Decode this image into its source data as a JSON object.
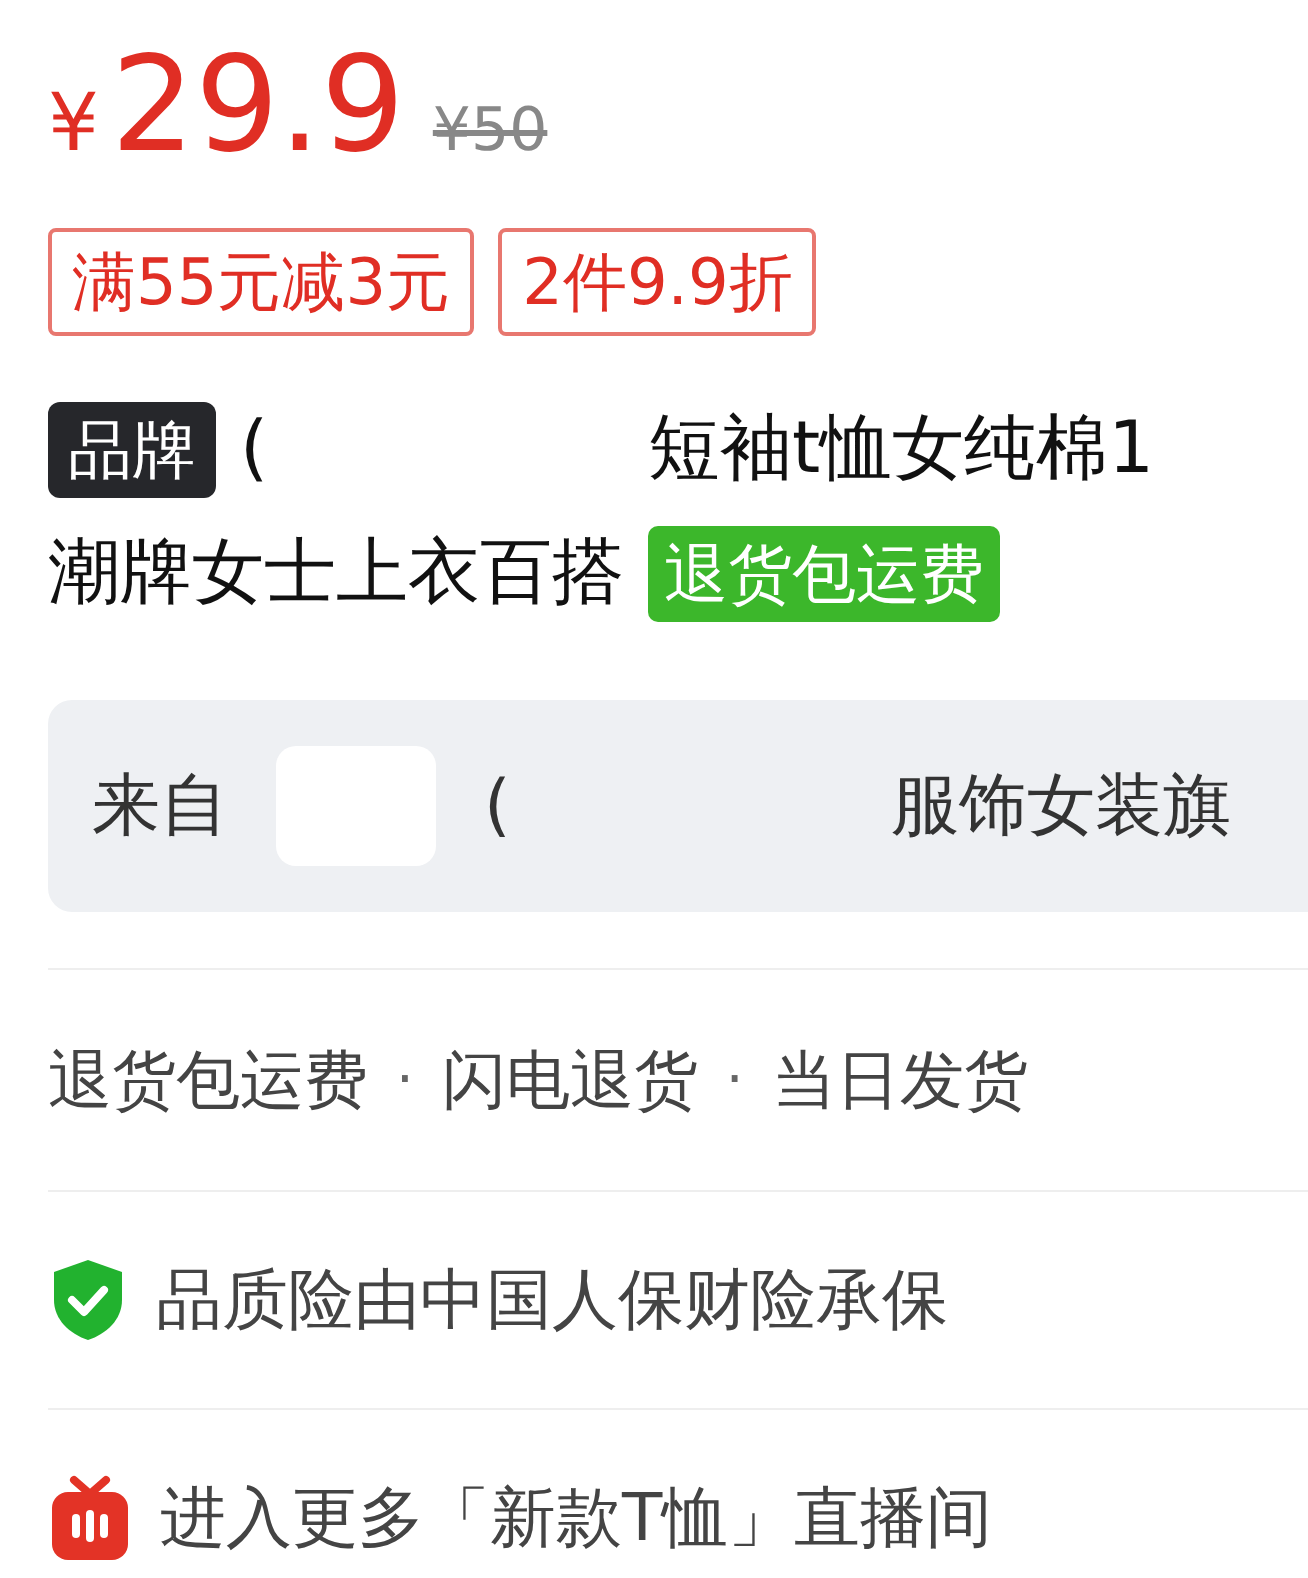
{
  "price": {
    "currency": "¥",
    "amount": "29.9",
    "original": "¥50"
  },
  "coupons": [
    "满55元减3元",
    "2件9.9折"
  ],
  "title": {
    "badge": "品牌",
    "line1_start": "(",
    "line1_end": "短袖t恤女纯棉1",
    "line2": "潮牌女士上衣百搭",
    "tag": "退货包运费"
  },
  "store": {
    "prefix": "来自",
    "name_start": "(",
    "name_end": "服饰女装旗"
  },
  "services": [
    {
      "label": "退货包运费"
    },
    {
      "label": "闪电退货"
    },
    {
      "label": "当日发货"
    }
  ],
  "service_separator": "·",
  "rows": [
    {
      "kind": "insurance",
      "text": "品质险由中国人保财险承保"
    },
    {
      "kind": "live",
      "text": "进入更多「新款T恤」直播间"
    }
  ]
}
